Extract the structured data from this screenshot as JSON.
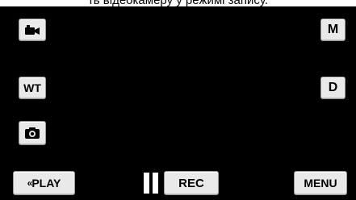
{
  "caption": "ть відеокамеру у режимі запису.",
  "top_left": {
    "icon": "video-camera-icon"
  },
  "top_right": {
    "label": "M"
  },
  "left_middle": {
    "label": "WT"
  },
  "right_middle": {
    "label": "D"
  },
  "left_lower": {
    "icon": "still-camera-icon"
  },
  "bottom": {
    "play_label": "PLAY",
    "play_prefix": "«",
    "pause_icon": "pause-icon",
    "rec_label": "REC",
    "menu_label": "MENU"
  }
}
